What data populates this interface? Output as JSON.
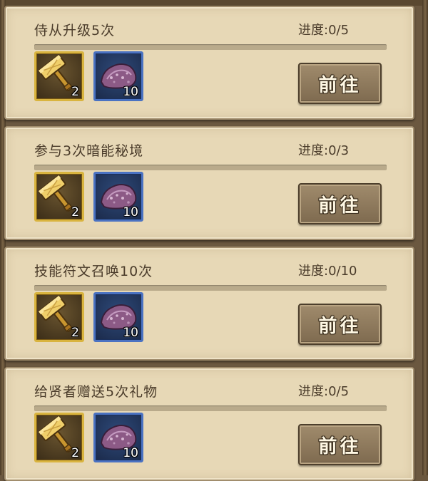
{
  "button_label": "前往",
  "icons": {
    "reward_1": "golden-hammer-icon",
    "reward_2": "purple-ore-icon"
  },
  "colors": {
    "card_bg": "#e7d8b6",
    "gold_frame": "#d9b43f",
    "blue_frame": "#4a72c2",
    "button": "#8f7a5c"
  },
  "tasks": [
    {
      "title": "侍从升级5次",
      "progress": "进度:0/5",
      "progress_value": 0,
      "rewards": [
        {
          "icon": "golden-hammer-icon",
          "count": "2"
        },
        {
          "icon": "purple-ore-icon",
          "count": "10"
        }
      ]
    },
    {
      "title": "参与3次暗能秘境",
      "progress": "进度:0/3",
      "progress_value": 0,
      "rewards": [
        {
          "icon": "golden-hammer-icon",
          "count": "2"
        },
        {
          "icon": "purple-ore-icon",
          "count": "10"
        }
      ]
    },
    {
      "title": "技能符文召唤10次",
      "progress": "进度:0/10",
      "progress_value": 0,
      "rewards": [
        {
          "icon": "golden-hammer-icon",
          "count": "2"
        },
        {
          "icon": "purple-ore-icon",
          "count": "10"
        }
      ]
    },
    {
      "title": "给贤者赠送5次礼物",
      "progress": "进度:0/5",
      "progress_value": 0,
      "rewards": [
        {
          "icon": "golden-hammer-icon",
          "count": "2"
        },
        {
          "icon": "purple-ore-icon",
          "count": "10"
        }
      ]
    }
  ]
}
